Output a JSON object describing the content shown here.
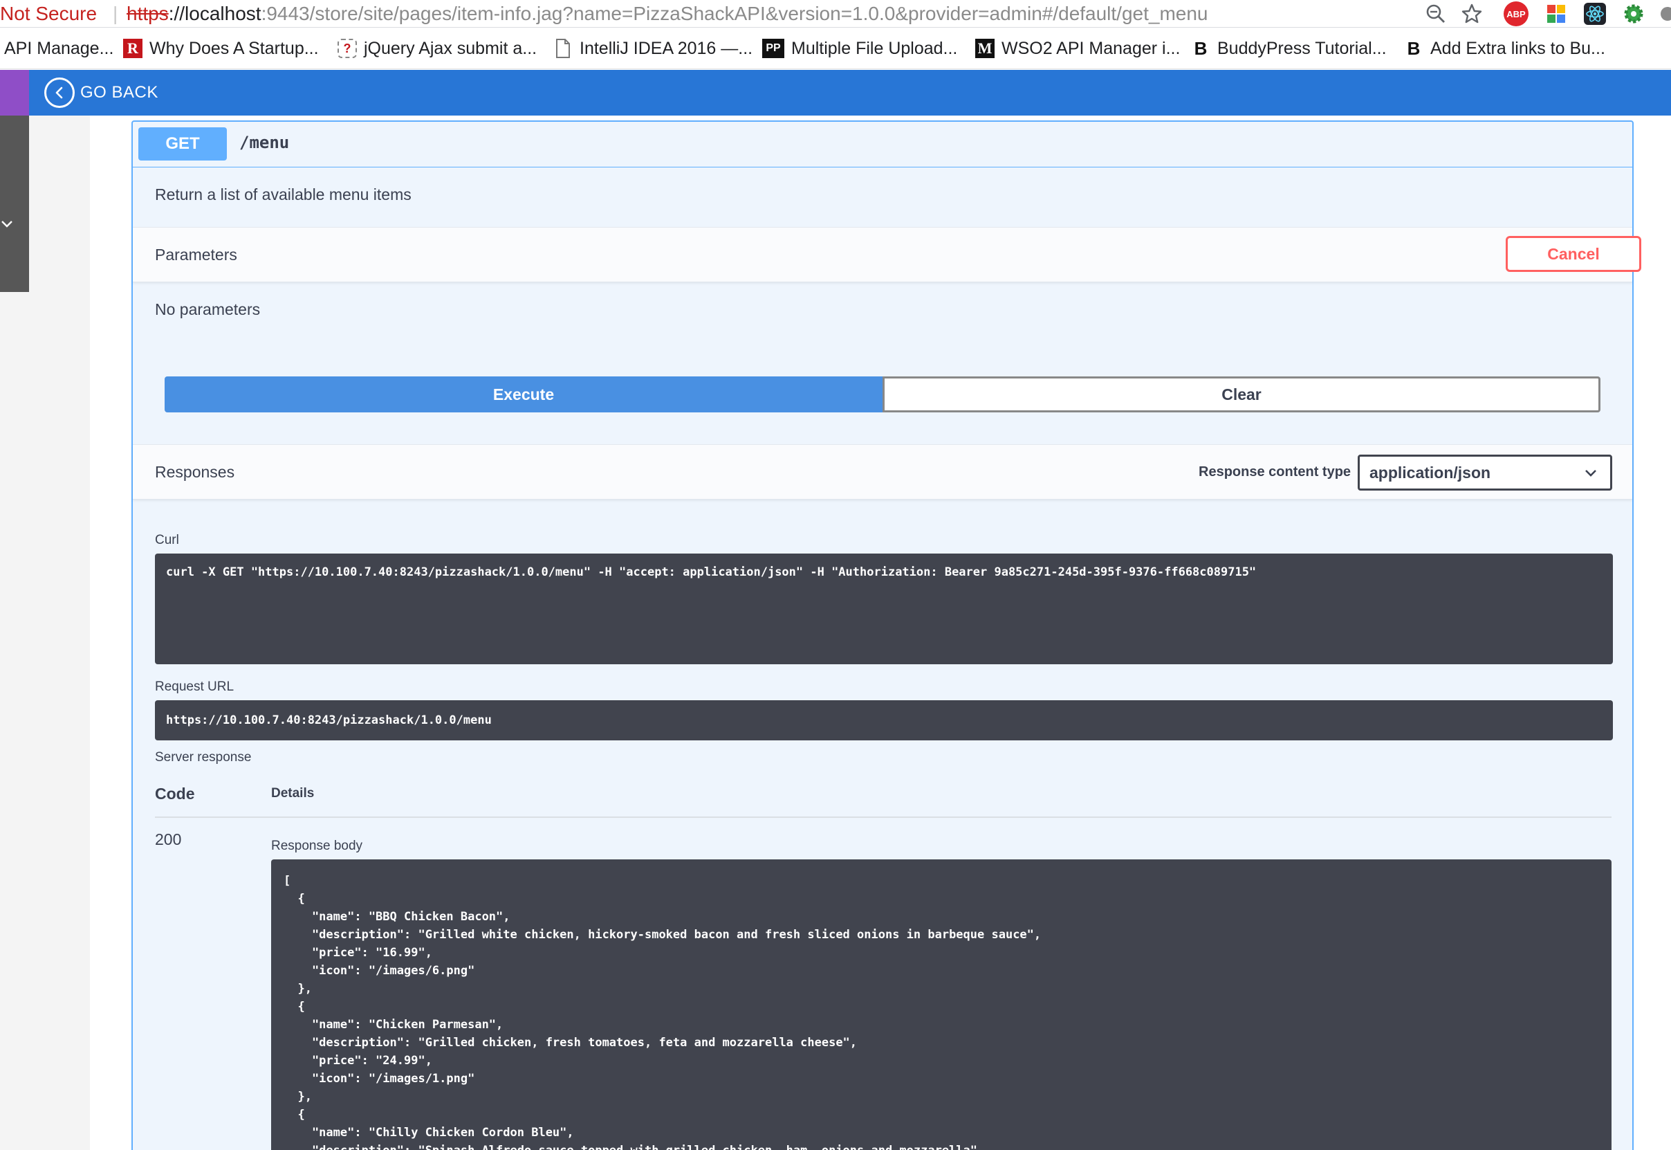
{
  "browser": {
    "security_label": "Not Secure",
    "url_scheme": "https",
    "url_host": "://localhost",
    "url_rest": ":9443/store/site/pages/item-info.jag?name=PizzaShackAPI&version=1.0.0&provider=admin#/default/get_menu",
    "extension_abp": "ABP"
  },
  "bookmarks": [
    {
      "label": "API Manage...",
      "icon": "none"
    },
    {
      "label": "Why Does A Startup...",
      "icon": "R"
    },
    {
      "label": "jQuery Ajax submit a...",
      "icon": "?"
    },
    {
      "label": "IntelliJ IDEA 2016 —...",
      "icon": "page"
    },
    {
      "label": "Multiple File Upload...",
      "icon": "PP"
    },
    {
      "label": "WSO2 API Manager i...",
      "icon": "M"
    },
    {
      "label": "BuddyPress Tutorial...",
      "icon": "B"
    },
    {
      "label": "Add Extra links to Bu...",
      "icon": "B"
    }
  ],
  "header": {
    "go_back_label": "GO BACK"
  },
  "operation": {
    "method": "GET",
    "path": "/menu",
    "description": "Return a list of available menu items",
    "parameters_title": "Parameters",
    "cancel_label": "Cancel",
    "no_parameters": "No parameters",
    "execute_label": "Execute",
    "clear_label": "Clear",
    "responses_title": "Responses",
    "response_content_type_label": "Response content type",
    "response_content_type_value": "application/json"
  },
  "live_response": {
    "curl_label": "Curl",
    "curl_command": "curl -X GET \"https://10.100.7.40:8243/pizzashack/1.0.0/menu\" -H \"accept: application/json\" -H \"Authorization: Bearer 9a85c271-245d-395f-9376-ff668c089715\"",
    "request_url_label": "Request URL",
    "request_url": "https://10.100.7.40:8243/pizzashack/1.0.0/menu",
    "server_response_label": "Server response",
    "code_header": "Code",
    "details_header": "Details",
    "status_code": "200",
    "response_body_label": "Response body",
    "response_body": "[\n  {\n    \"name\": \"BBQ Chicken Bacon\",\n    \"description\": \"Grilled white chicken, hickory-smoked bacon and fresh sliced onions in barbeque sauce\",\n    \"price\": \"16.99\",\n    \"icon\": \"/images/6.png\"\n  },\n  {\n    \"name\": \"Chicken Parmesan\",\n    \"description\": \"Grilled chicken, fresh tomatoes, feta and mozzarella cheese\",\n    \"price\": \"24.99\",\n    \"icon\": \"/images/1.png\"\n  },\n  {\n    \"name\": \"Chilly Chicken Cordon Bleu\",\n    \"description\": \"Spinash Alfredo sauce topped with grilled chicken, ham, onions and mozzarella\","
  },
  "colors": {
    "header_blue": "#2876d6",
    "get_blue": "#61affe",
    "execute_blue": "#4990e2",
    "cancel_red": "#ff6060",
    "code_bg": "#41444e",
    "not_secure_red": "#c5221f"
  }
}
